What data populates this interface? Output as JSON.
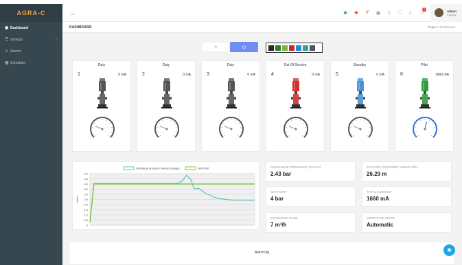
{
  "brand": "AGRA-C",
  "sidebar": {
    "items": [
      {
        "label": "Dashboard",
        "icon": "dashboard-icon",
        "active": true
      },
      {
        "label": "Settings",
        "icon": "settings-icon",
        "has_submenu": true
      },
      {
        "label": "Alarms",
        "icon": "alarm-icon"
      },
      {
        "label": "Scheduler",
        "icon": "calendar-icon"
      }
    ]
  },
  "topbar": {
    "notification_count": "9",
    "user_name": "Admin",
    "user_role": "Factory"
  },
  "breadcrumb": {
    "title": "DASHBOARD",
    "items": [
      "Pages",
      "Dashboard"
    ],
    "separator": ">"
  },
  "colors": {
    "sidebar": "#37474f",
    "accent": "#6f8df3",
    "pump_gray": "#555555",
    "pump_red": "#d32f2f",
    "pump_blue": "#4a90d9",
    "pump_green": "#2e9e3e",
    "chart_pressure": "#5bc0c0",
    "chart_setpoint": "#7ac943"
  },
  "palette": [
    "#2a2a2a",
    "#2e7d32",
    "#7cb342",
    "#c62828",
    "#1e88e5",
    "#3d9b94",
    "#455a64"
  ],
  "pumps": [
    {
      "num": "1",
      "status": "Duty",
      "current": "0 mA",
      "color": "gray",
      "gauge_level": 0.25
    },
    {
      "num": "2",
      "status": "Duty",
      "current": "0 mA",
      "color": "gray",
      "gauge_level": 0.25
    },
    {
      "num": "3",
      "status": "Duty",
      "current": "0 mA",
      "color": "gray",
      "gauge_level": 0.25
    },
    {
      "num": "4",
      "status": "Out Of Service",
      "current": "0 mA",
      "color": "red",
      "gauge_level": 0.25
    },
    {
      "num": "5",
      "status": "Standby",
      "current": "0 mA",
      "color": "blue",
      "gauge_level": 0.25
    },
    {
      "num": "6",
      "status": "Pilot",
      "current": "1660 mA",
      "color": "green",
      "gauge_level": 0.55
    }
  ],
  "metrics": [
    {
      "label": "Discharge pressure (gauge)",
      "value": "2.43 bar"
    },
    {
      "label": "Suction pressure (absolute)",
      "value": "26.29 m"
    },
    {
      "label": "Set point",
      "value": "4 bar"
    },
    {
      "label": "Total current",
      "value": "1660 mA"
    },
    {
      "label": "Estimated flow",
      "value": "7 m³/h"
    },
    {
      "label": "Operation mode",
      "value": "Automatic"
    }
  ],
  "alarm_log": {
    "title": "Alarm log"
  },
  "chart_data": {
    "type": "line",
    "ylim": [
      0,
      5
    ],
    "yticks": [
      "5.0",
      "4.5",
      "4.0",
      "3.5",
      "3.0",
      "2.5",
      "2.0",
      "1.5",
      "1.0",
      "0.5",
      "0"
    ],
    "ylabel": "Value",
    "legend": "top-center",
    "series": [
      {
        "name": "Discharge pressure sensor (Gauge)",
        "color": "#5bc0c0",
        "values": [
          0.3,
          4.05,
          4.05,
          4.05,
          4.05,
          4.05,
          4.05,
          4.05,
          4.05,
          4.05,
          4.05,
          4.05,
          4.05,
          4.05,
          4.05,
          4.05,
          4.05,
          4.05,
          4.05,
          4.05,
          4.05,
          4.05,
          4.1,
          4.3,
          4.85,
          4.5,
          3.5,
          3.6,
          3.3,
          3.05,
          2.9,
          2.7,
          2.6,
          2.55,
          2.5,
          2.45,
          2.43,
          2.43,
          2.43,
          2.43,
          2.43,
          2.43
        ]
      },
      {
        "name": "Set Point",
        "color": "#7ac943",
        "values": [
          0.3,
          4.0,
          4.0,
          4.0,
          4.0,
          4.0,
          4.0,
          4.0,
          4.0,
          4.0,
          4.0,
          4.0,
          4.0,
          4.0,
          4.0,
          4.0,
          4.0,
          4.0,
          4.0,
          4.0,
          4.0,
          4.0,
          4.0,
          4.0,
          4.0,
          4.0,
          4.0,
          4.0,
          4.0,
          4.0,
          4.0,
          4.0,
          4.0,
          4.0,
          4.0,
          4.0,
          4.0,
          4.0,
          4.0,
          4.0,
          4.0,
          4.0
        ]
      }
    ]
  }
}
